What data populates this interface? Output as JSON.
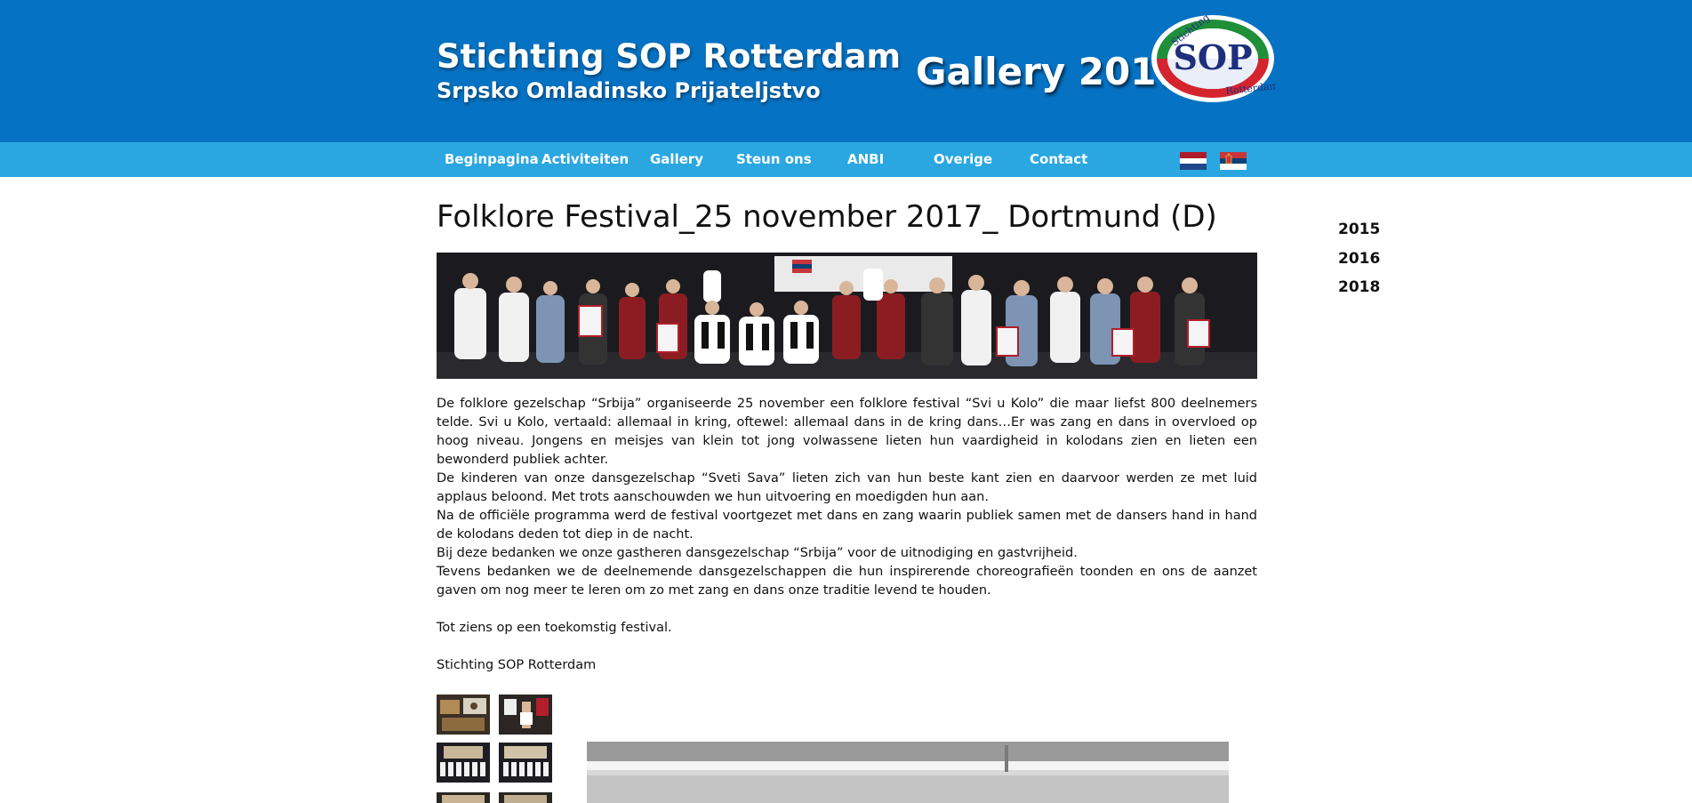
{
  "header": {
    "site_title": "Stichting SOP Rotterdam",
    "site_subtitle": "Srpsko Omladinsko Prijateljstvo",
    "gallery_heading": "Gallery 2017",
    "logo_top_text": "Stichting",
    "logo_main_text": "SOP",
    "logo_bottom_text": "Rotterdam"
  },
  "nav": {
    "items": [
      {
        "label": "Beginpagina"
      },
      {
        "label": "Activiteiten"
      },
      {
        "label": "Gallery"
      },
      {
        "label": "Steun ons"
      },
      {
        "label": "ANBI"
      },
      {
        "label": "Overige"
      },
      {
        "label": "Contact"
      }
    ],
    "flags": [
      "flag-netherlands-icon",
      "flag-serbia-icon"
    ]
  },
  "colors": {
    "header_bg": "#0672c3",
    "nav_bg": "#2aa7e0",
    "text": "#111111"
  },
  "main": {
    "title": "Folklore Festival_25 november 2017_ Dortmund (D)",
    "paragraphs": [
      "De folklore gezelschap “Srbija” organiseerde 25 november een folklore festival “Svi u Kolo” die maar liefst 800 deelnemers telde. Svi u Kolo, vertaald: allemaal in kring, oftewel: allemaal dans in de kring dans…Er was zang en dans in overvloed op hoog niveau. Jongens en meisjes van klein tot jong volwassene lieten hun vaardigheid in kolodans zien en lieten een bewonderd publiek achter.",
      "De kinderen van onze dansgezelschap “Sveti Sava” lieten zich van hun beste kant zien en daarvoor werden ze  met luid applaus beloond. Met trots aanschouwden we hun uitvoering en moedigden hun aan.",
      "Na de officiële programma werd de festival voortgezet met dans en zang waarin publiek samen met de dansers hand in hand de kolodans deden tot diep in de nacht.",
      "Bij deze bedanken we onze gastheren dansgezelschap “Srbija” voor de uitnodiging en gastvrijheid.",
      "Tevens bedanken we de deelnemende dansgezelschappen die hun inspirerende choreografieën toonden en ons de aanzet gaven om nog meer te leren om zo met zang en dans onze traditie levend te houden.",
      "Tot ziens op een toekomstig festival.",
      "Stichting SOP Rotterdam"
    ]
  },
  "sidebar": {
    "years": [
      {
        "label": "2015"
      },
      {
        "label": "2016"
      },
      {
        "label": "2018"
      }
    ]
  }
}
